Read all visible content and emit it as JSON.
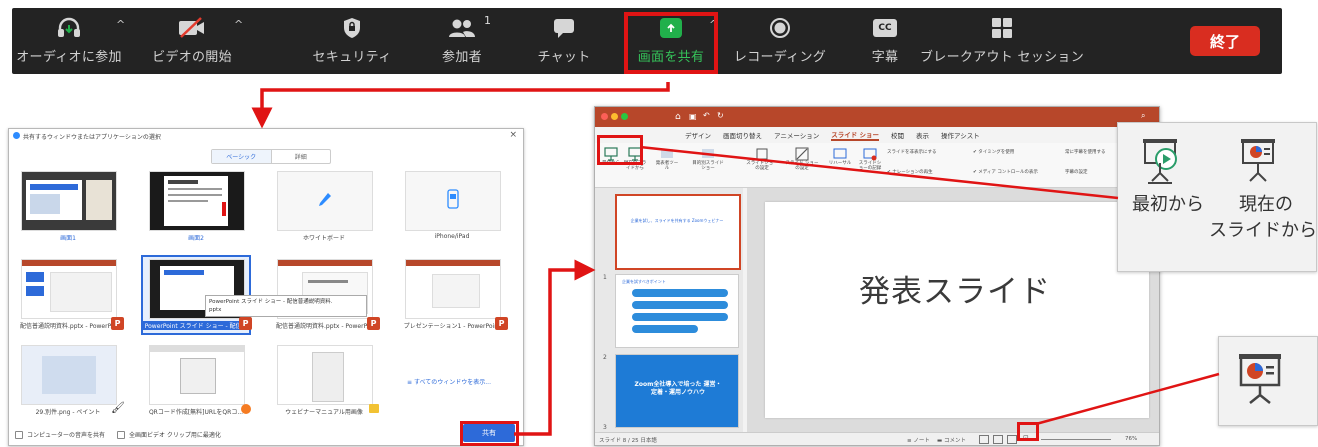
{
  "toolbar": {
    "items": [
      {
        "label": "オーディオに参加",
        "icon": "headphones-icon"
      },
      {
        "label": "ビデオの開始",
        "icon": "video-off-icon"
      },
      {
        "label": "セキュリティ",
        "icon": "shield-icon"
      },
      {
        "label": "参加者",
        "icon": "participants-icon",
        "count": "1"
      },
      {
        "label": "チャット",
        "icon": "chat-icon"
      },
      {
        "label": "画面を共有",
        "icon": "share-screen-icon"
      },
      {
        "label": "レコーディング",
        "icon": "record-icon"
      },
      {
        "label": "字幕",
        "icon": "cc-icon",
        "badge": "CC"
      },
      {
        "label": "ブレークアウト セッション",
        "icon": "breakout-icon"
      }
    ],
    "end_label": "終了",
    "accent": "#21b04b",
    "end_color": "#d92d20",
    "highlight_color": "#e01414"
  },
  "share_dialog": {
    "title": "共有するウィンドウまたはアプリケーションの選択",
    "tabs": [
      "ベーシック",
      "詳細"
    ],
    "active_tab": "ベーシック",
    "tiles": [
      {
        "label": "画面1"
      },
      {
        "label": "画面2"
      },
      {
        "label": "ホワイトボード"
      },
      {
        "label": "iPhone/iPad"
      },
      {
        "label": "配信普通説明資料.pptx - PowerP..."
      },
      {
        "label": "PowerPoint スライド ショー - 配信..."
      },
      {
        "label": "配信普通説明資料.pptx - PowerP..."
      },
      {
        "label": "プレゼンテーション1 - PowerPoint"
      },
      {
        "label": "29.別件.png - ペイント"
      },
      {
        "label": "QRコード作成[無料]URLをQRコ..."
      },
      {
        "label": "ウェビナーマニュアル用画像"
      }
    ],
    "tooltip_line1": "PowerPoint スライド ショー - 配信普通説明資料.",
    "tooltip_line2": "pptx",
    "show_all": "すべてのウィンドウを表示...",
    "footer_sound": "コンピューターの音声を共有",
    "footer_optimize": "全画面ビデオ クリップ用に最適化",
    "share_button": "共有"
  },
  "powerpoint": {
    "ribbon_tabs": [
      "デザイン",
      "画面切り替え",
      "アニメーション",
      "スライド ショー",
      "校閲",
      "表示",
      "操作アシスト"
    ],
    "active_tab": "スライド ショー",
    "share_label": "共有",
    "ribbon_buttons": [
      {
        "label": "最初から"
      },
      {
        "label": "現在のスライドから"
      },
      {
        "label": "発表者ツール"
      },
      {
        "label": "目的別スライドショー"
      },
      {
        "label": "スライドショーの設定"
      },
      {
        "label": "スライド ショーの設定"
      },
      {
        "label": "リハーサル"
      },
      {
        "label": "スライドショーの記録"
      }
    ],
    "ribbon_checks": [
      "スライドを非表示にする",
      "タイミングを使用",
      "ナレーションの再生",
      "メディア コントロールの表示",
      "常に字幕を使用する",
      "字幕の設定"
    ],
    "slide_main_text": "発表スライド",
    "thumb_texts": [
      "企業を試し、スライドを共有する Zoomウェビナー",
      "企業を試すべきポイント",
      "Zoom全社導入で培った 運営・定着・運用ノウハウ"
    ],
    "status_left": "スライド 8 / 25 日本語",
    "status_notes": "ノート",
    "status_comments": "コメント",
    "zoom": "76%"
  },
  "callout_big": {
    "left_label": "最初から",
    "right_label_1": "現在の",
    "right_label_2": "スライドから"
  }
}
